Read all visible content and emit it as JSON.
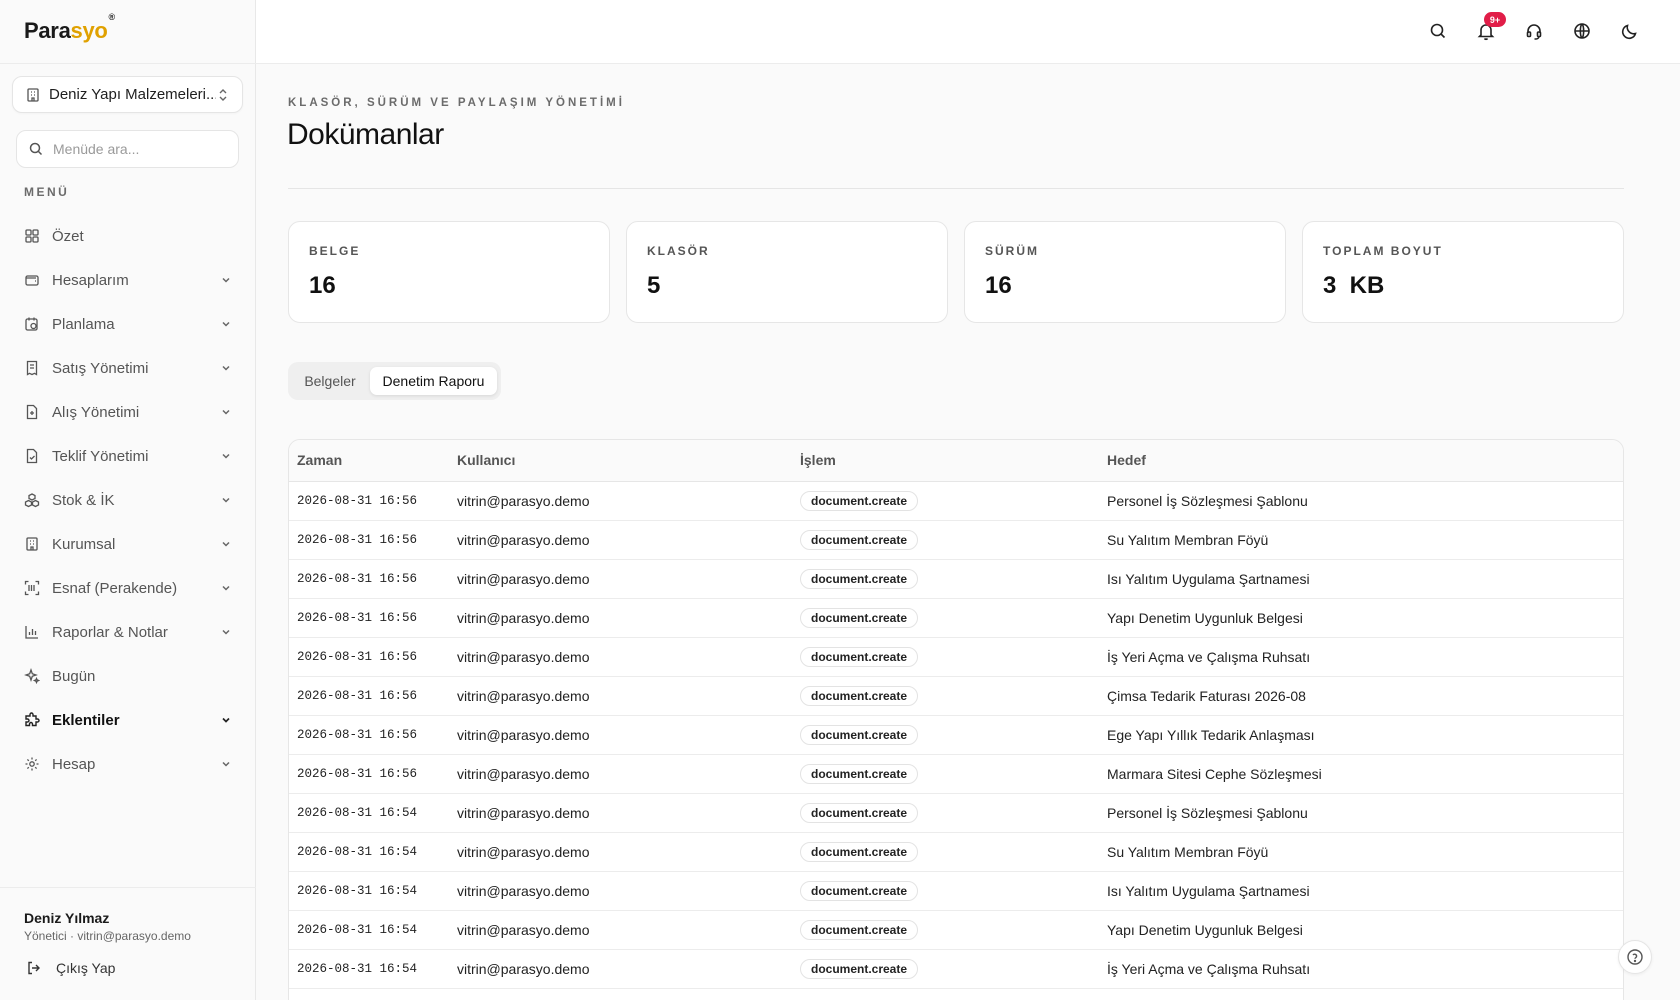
{
  "brand": {
    "part1": "Para",
    "part2": "syo",
    "mark": "®"
  },
  "company": {
    "name": "Deniz Yapı Malzemeleri..."
  },
  "search": {
    "placeholder": "Menüde ara..."
  },
  "menu_title": "MENÜ",
  "nav": [
    {
      "label": "Özet",
      "icon": "dashboard-icon",
      "chevron": false,
      "active": false
    },
    {
      "label": "Hesaplarım",
      "icon": "wallet-icon",
      "chevron": true,
      "active": false
    },
    {
      "label": "Planlama",
      "icon": "calendar-clock-icon",
      "chevron": true,
      "active": false
    },
    {
      "label": "Satış Yönetimi",
      "icon": "receipt-icon",
      "chevron": true,
      "active": false
    },
    {
      "label": "Alış Yönetimi",
      "icon": "file-plus-icon",
      "chevron": true,
      "active": false
    },
    {
      "label": "Teklif Yönetimi",
      "icon": "file-check-icon",
      "chevron": true,
      "active": false
    },
    {
      "label": "Stok & İK",
      "icon": "boxes-icon",
      "chevron": true,
      "active": false
    },
    {
      "label": "Kurumsal",
      "icon": "building-icon",
      "chevron": true,
      "active": false
    },
    {
      "label": "Esnaf (Perakende)",
      "icon": "barcode-scan-icon",
      "chevron": true,
      "active": false
    },
    {
      "label": "Raporlar & Notlar",
      "icon": "bar-chart-icon",
      "chevron": true,
      "active": false
    },
    {
      "label": "Bugün",
      "icon": "sparkles-icon",
      "chevron": false,
      "active": false
    },
    {
      "label": "Eklentiler",
      "icon": "puzzle-icon",
      "chevron": true,
      "active": true
    },
    {
      "label": "Hesap",
      "icon": "gear-icon",
      "chevron": true,
      "active": false
    }
  ],
  "user": {
    "name": "Deniz Yılmaz",
    "role": "Yönetici · vitrin@parasyo.demo"
  },
  "logout_label": "Çıkış Yap",
  "topbar": {
    "notification_badge": "9+"
  },
  "page": {
    "eyebrow": "KLASÖR, SÜRÜM VE PAYLAŞIM YÖNETİMİ",
    "title": "Dokümanlar"
  },
  "stats": [
    {
      "label": "BELGE",
      "value": "16"
    },
    {
      "label": "KLASÖR",
      "value": "5"
    },
    {
      "label": "SÜRÜM",
      "value": "16"
    },
    {
      "label": "TOPLAM BOYUT",
      "value": "3  KB"
    }
  ],
  "tabs": {
    "documents": "Belgeler",
    "audit": "Denetim Raporu",
    "active": "audit"
  },
  "table": {
    "headers": [
      "Zaman",
      "Kullanıcı",
      "İşlem",
      "Hedef"
    ],
    "rows": [
      [
        "2026-08-31 16:56",
        "vitrin@parasyo.demo",
        "document.create",
        "Personel İş Sözleşmesi Şablonu"
      ],
      [
        "2026-08-31 16:56",
        "vitrin@parasyo.demo",
        "document.create",
        "Su Yalıtım Membran Föyü"
      ],
      [
        "2026-08-31 16:56",
        "vitrin@parasyo.demo",
        "document.create",
        "Isı Yalıtım Uygulama Şartnamesi"
      ],
      [
        "2026-08-31 16:56",
        "vitrin@parasyo.demo",
        "document.create",
        "Yapı Denetim Uygunluk Belgesi"
      ],
      [
        "2026-08-31 16:56",
        "vitrin@parasyo.demo",
        "document.create",
        "İş Yeri Açma ve Çalışma Ruhsatı"
      ],
      [
        "2026-08-31 16:56",
        "vitrin@parasyo.demo",
        "document.create",
        "Çimsa Tedarik Faturası 2026-08"
      ],
      [
        "2026-08-31 16:56",
        "vitrin@parasyo.demo",
        "document.create",
        "Ege Yapı Yıllık Tedarik Anlaşması"
      ],
      [
        "2026-08-31 16:56",
        "vitrin@parasyo.demo",
        "document.create",
        "Marmara Sitesi Cephe Sözleşmesi"
      ],
      [
        "2026-08-31 16:54",
        "vitrin@parasyo.demo",
        "document.create",
        "Personel İş Sözleşmesi Şablonu"
      ],
      [
        "2026-08-31 16:54",
        "vitrin@parasyo.demo",
        "document.create",
        "Su Yalıtım Membran Föyü"
      ],
      [
        "2026-08-31 16:54",
        "vitrin@parasyo.demo",
        "document.create",
        "Isı Yalıtım Uygulama Şartnamesi"
      ],
      [
        "2026-08-31 16:54",
        "vitrin@parasyo.demo",
        "document.create",
        "Yapı Denetim Uygunluk Belgesi"
      ],
      [
        "2026-08-31 16:54",
        "vitrin@parasyo.demo",
        "document.create",
        "İş Yeri Açma ve Çalışma Ruhsatı"
      ]
    ]
  },
  "colors": {
    "brand_accent": "#e0a100",
    "badge": "#e11d48"
  }
}
